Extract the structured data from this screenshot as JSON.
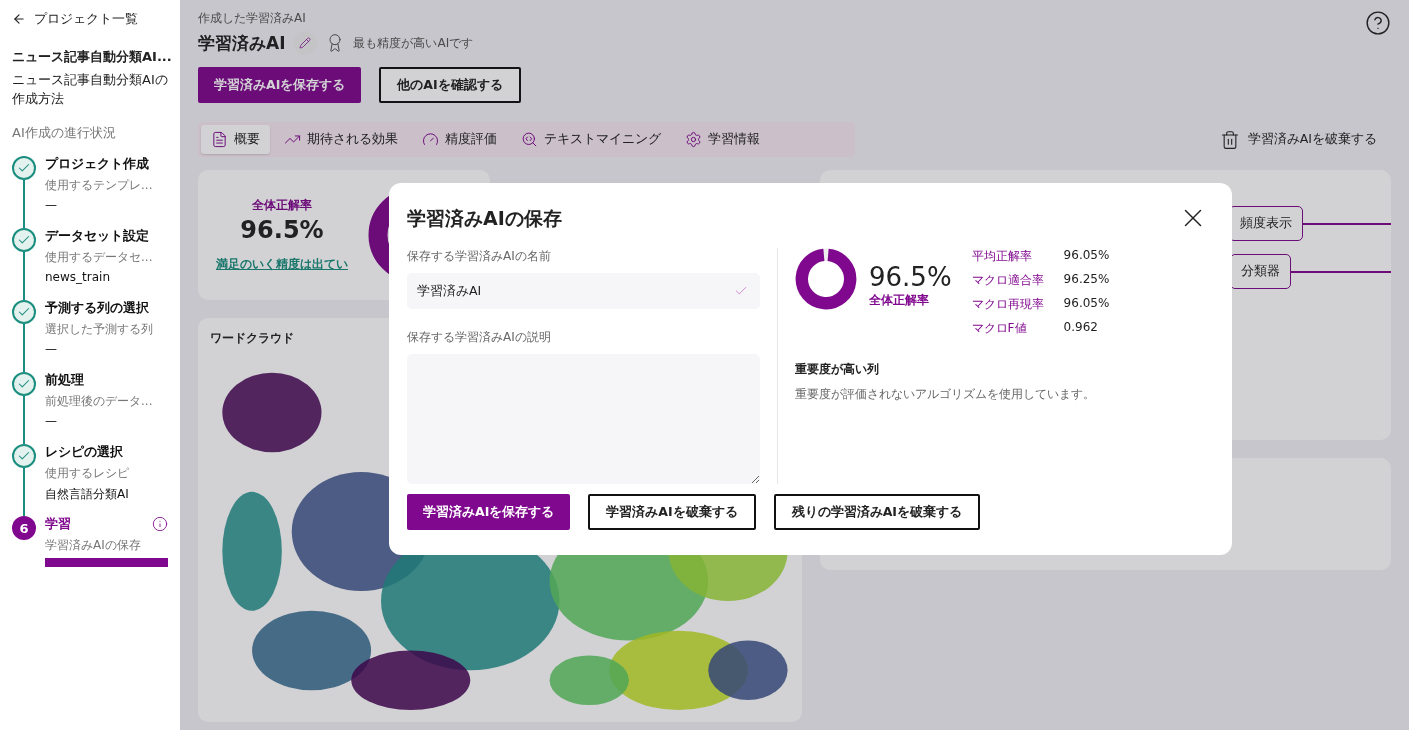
{
  "sidebar": {
    "back_link": "プロジェクト一覧",
    "project_title": "ニュース記事自動分類AI...",
    "project_subtitle": "ニュース記事自動分類AIの作成方法",
    "progress_heading": "AI作成の進行状況",
    "steps": [
      {
        "title": "プロジェクト作成",
        "label": "使用するテンプレ...",
        "value": "—",
        "completed": true
      },
      {
        "title": "データセット設定",
        "label": "使用するデータセ...",
        "value": "news_train",
        "completed": true
      },
      {
        "title": "予測する列の選択",
        "label": "選択した予測する列",
        "value": "—",
        "completed": true
      },
      {
        "title": "前処理",
        "label": "前処理後のデータ...",
        "value": "—",
        "completed": true
      },
      {
        "title": "レシピの選択",
        "label": "使用するレシピ",
        "value": "自然言語分類AI",
        "completed": true
      },
      {
        "title": "学習",
        "label": "学習済みAIの保存",
        "completed": false,
        "number": "6",
        "level": 1
      }
    ]
  },
  "header": {
    "caption": "作成した学習済みAI",
    "title": "学習済みAI",
    "badge": "最も精度が高いAIです",
    "buttons": [
      {
        "label": "学習済みAIを保存する",
        "kind": "primary"
      },
      {
        "label": "他のAIを確認する",
        "kind": "outline"
      }
    ]
  },
  "tabs": [
    {
      "label": "概要",
      "selected": true
    },
    {
      "label": "期待される効果",
      "selected": false
    },
    {
      "label": "精度評価",
      "selected": false
    },
    {
      "label": "テキストマイニング",
      "selected": false
    },
    {
      "label": "学習情報",
      "selected": false
    }
  ],
  "discard_button": "学習済みAIを破棄する",
  "accuracy_card": {
    "label": "全体正解率",
    "value": "96.5%",
    "link": "満足のいく精度は出てい"
  },
  "wordcloud_card": {
    "title": "ワードクラウド"
  },
  "model_tree": {
    "nodes": [
      "頻度表示",
      "分類器"
    ]
  },
  "modal": {
    "title": "学習済みAIの保存",
    "name_label": "保存する学習済みAIの名前",
    "name_value": "学習済みAI",
    "description_label": "保存する学習済みAIの説明",
    "accuracy": {
      "value": "96.5%",
      "label": "全体正解率",
      "level": 0.965
    },
    "metrics": [
      {
        "name": "平均正解率",
        "value": "96.05%"
      },
      {
        "name": "マクロ適合率",
        "value": "96.25%"
      },
      {
        "name": "マクロ再現率",
        "value": "96.05%"
      },
      {
        "name": "マクロF値",
        "value": "0.962"
      }
    ],
    "importance_heading": "重要度が高い列",
    "importance_text": "重要度が評価されないアルゴリズムを使用しています。",
    "buttons": [
      {
        "label": "学習済みAIを保存する",
        "kind": "primary"
      },
      {
        "label": "学習済みAIを破棄する",
        "kind": "outline"
      },
      {
        "label": "残りの学習済みAIを破棄する",
        "kind": "outline"
      }
    ]
  }
}
